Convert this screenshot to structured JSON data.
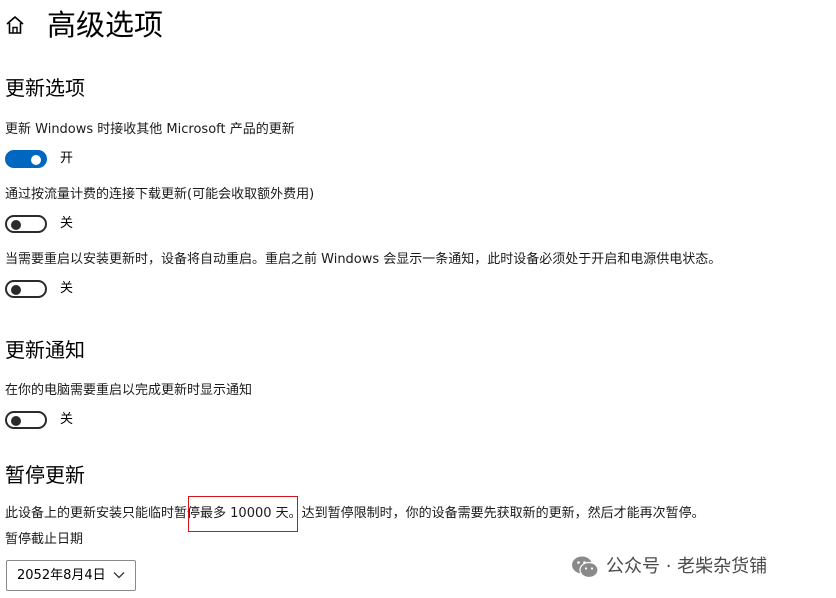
{
  "header": {
    "title": "高级选项",
    "home_icon": "home-icon"
  },
  "update_options": {
    "heading": "更新选项",
    "settings": [
      {
        "label": "更新 Windows 时接收其他 Microsoft 产品的更新",
        "state": "开",
        "on": true
      },
      {
        "label": "通过按流量计费的连接下载更新(可能会收取额外费用)",
        "state": "关",
        "on": false
      },
      {
        "label": "当需要重启以安装更新时，设备将自动重启。重启之前 Windows 会显示一条通知，此时设备必须处于开启和电源供电状态。",
        "state": "关",
        "on": false
      }
    ]
  },
  "update_notifications": {
    "heading": "更新通知",
    "setting": {
      "label": "在你的电脑需要重启以完成更新时显示通知",
      "state": "关",
      "on": false
    }
  },
  "pause_updates": {
    "heading": "暂停更新",
    "desc_before": "此设备上的更新安装只能临时",
    "desc_highlight": "暂停最多 10000 天",
    "desc_after": "。达到暂停限制时，你的设备需要先获取新的更新，然后才能再次暂停。",
    "date_label": "暂停截止日期",
    "date_value": "2052年8月4日"
  },
  "watermark": {
    "text": "公众号 · 老柴杂货铺"
  },
  "colors": {
    "accent": "#0067c0",
    "highlight_border": "#d4141d"
  }
}
